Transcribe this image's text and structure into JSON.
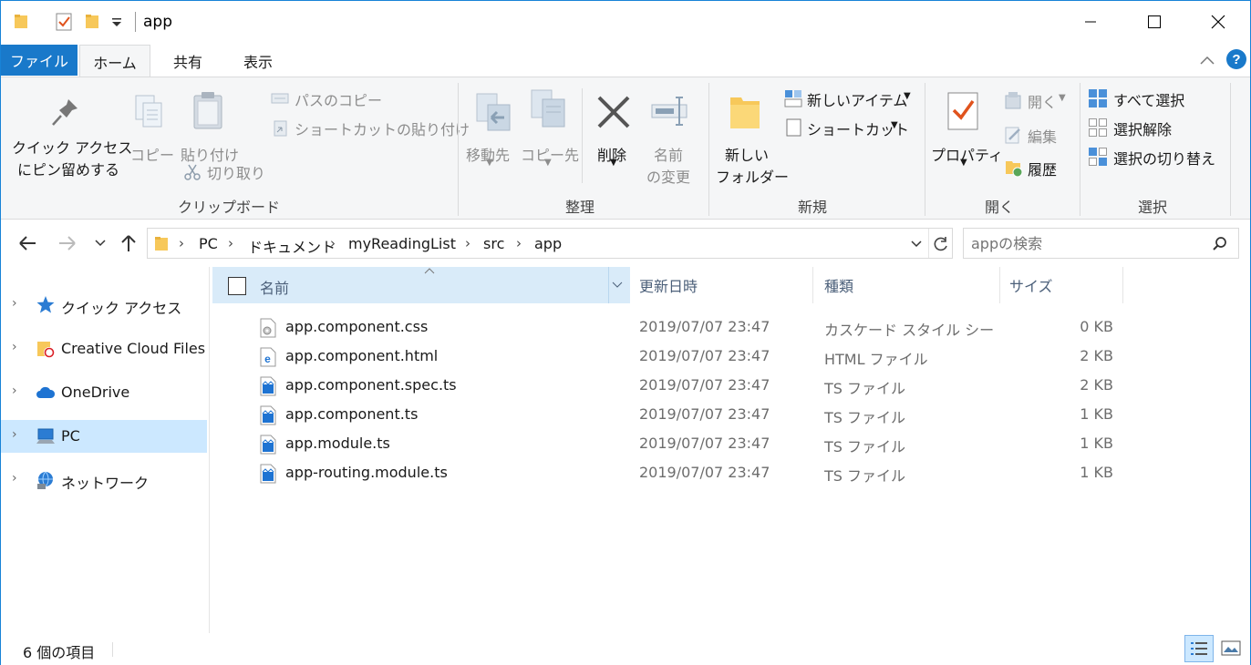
{
  "window": {
    "title": "app",
    "minimize_icon": "minimize-icon",
    "maximize_icon": "maximize-icon",
    "close_icon": "close-icon"
  },
  "ribbon_tabs": {
    "file": "ファイル",
    "home": "ホーム",
    "share": "共有",
    "view": "表示"
  },
  "ribbon": {
    "clipboard": {
      "pin_line1": "クイック アクセス",
      "pin_line2": "にピン留めする",
      "copy": "コピー",
      "paste": "貼り付け",
      "copy_path": "パスのコピー",
      "paste_shortcut": "ショートカットの貼り付け",
      "cut": "切り取り",
      "group": "クリップボード"
    },
    "organize": {
      "move_to": "移動先",
      "copy_to": "コピー先",
      "delete": "削除",
      "rename_line1": "名前",
      "rename_line2": "の変更",
      "group": "整理"
    },
    "new": {
      "new_folder_line1": "新しい",
      "new_folder_line2": "フォルダー",
      "new_item": "新しいアイテム",
      "easy_access": "ショートカット",
      "group": "新規"
    },
    "open": {
      "properties": "プロパティ",
      "open": "開く",
      "edit": "編集",
      "history": "履歴",
      "group": "開く"
    },
    "select": {
      "select_all": "すべて選択",
      "select_none": "選択解除",
      "invert": "選択の切り替え",
      "group": "選択"
    }
  },
  "address": {
    "crumbs": [
      "PC",
      "ドキュメント",
      "myReadingList",
      "src",
      "app"
    ],
    "search_placeholder": "appの検索"
  },
  "nav_pane": {
    "items": [
      {
        "label": "クイック アクセス",
        "icon": "star-icon"
      },
      {
        "label": "Creative Cloud Files",
        "icon": "creative-cloud-folder-icon"
      },
      {
        "label": "OneDrive",
        "icon": "cloud-icon"
      },
      {
        "label": "PC",
        "icon": "computer-icon"
      },
      {
        "label": "ネットワーク",
        "icon": "network-icon"
      }
    ]
  },
  "columns": {
    "name": "名前",
    "date": "更新日時",
    "type": "種類",
    "size": "サイズ"
  },
  "files": [
    {
      "name": "app.component.css",
      "date": "2019/07/07 23:47",
      "type": "カスケード スタイル シート…",
      "size": "0 KB",
      "icon": "css-file-icon"
    },
    {
      "name": "app.component.html",
      "date": "2019/07/07 23:47",
      "type": "HTML ファイル",
      "size": "2 KB",
      "icon": "html-file-icon"
    },
    {
      "name": "app.component.spec.ts",
      "date": "2019/07/07 23:47",
      "type": "TS ファイル",
      "size": "2 KB",
      "icon": "ts-file-icon"
    },
    {
      "name": "app.component.ts",
      "date": "2019/07/07 23:47",
      "type": "TS ファイル",
      "size": "1 KB",
      "icon": "ts-file-icon"
    },
    {
      "name": "app.module.ts",
      "date": "2019/07/07 23:47",
      "type": "TS ファイル",
      "size": "1 KB",
      "icon": "ts-file-icon"
    },
    {
      "name": "app-routing.module.ts",
      "date": "2019/07/07 23:47",
      "type": "TS ファイル",
      "size": "1 KB",
      "icon": "ts-file-icon"
    }
  ],
  "status": {
    "item_count": "6 個の項目"
  },
  "colors": {
    "accent": "#1979ca",
    "selection": "#cce8ff",
    "header_selected": "#d9ebf9",
    "ribbon_bg": "#f5f6f7",
    "folder": "#f7c85a"
  }
}
